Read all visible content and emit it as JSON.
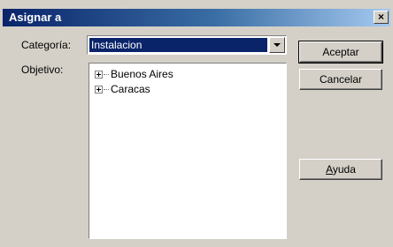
{
  "window": {
    "title": "Asignar a",
    "close_glyph": "×"
  },
  "form": {
    "category_label": "Categoría:",
    "category_value": "Instalacion",
    "objective_label": "Objetivo:"
  },
  "tree": {
    "items": [
      {
        "label": "Buenos Aires",
        "icon": "expand-plus-icon"
      },
      {
        "label": "Caracas",
        "icon": "expand-plus-icon"
      }
    ]
  },
  "buttons": {
    "accept": "Aceptar",
    "cancel": "Cancelar",
    "help_accel": "A",
    "help_rest": "yuda"
  },
  "colors": {
    "selection": "#0a246a",
    "dialog_bg": "#d4d0c8"
  }
}
